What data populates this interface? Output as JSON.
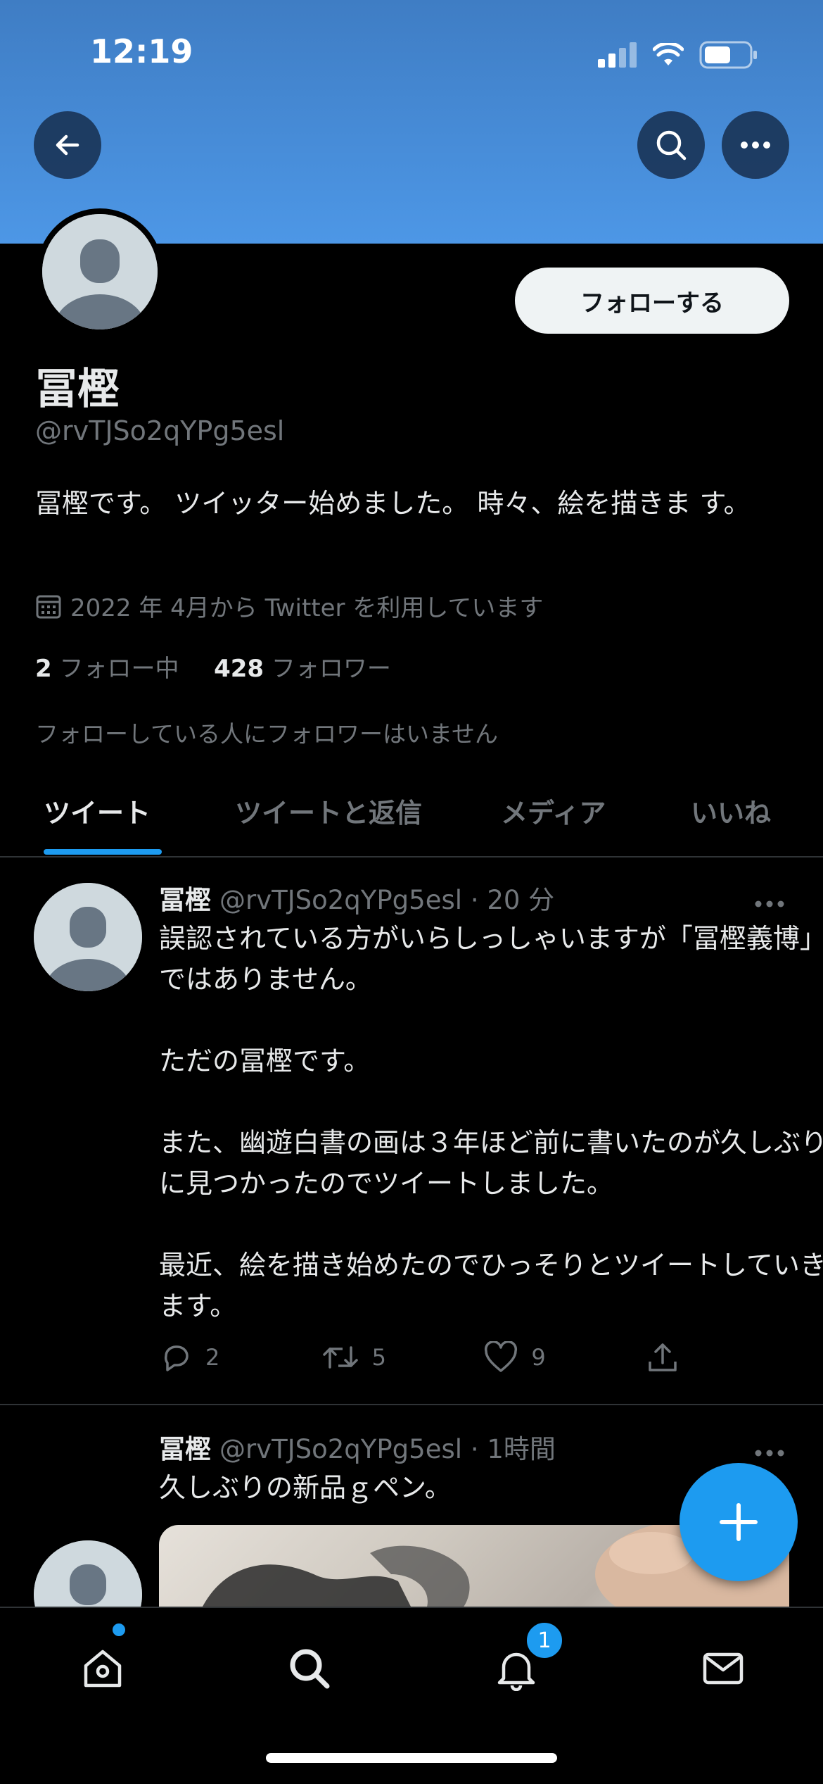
{
  "status": {
    "time": "12:19"
  },
  "header": {
    "back": "back",
    "search": "search",
    "more": "more"
  },
  "profile": {
    "follow_label": "フォローする",
    "name": "冨樫",
    "handle": "@rvTJSo2qYPg5esl",
    "bio": "冨樫です。 ツイッター始めました。 時々、絵を描きま す。",
    "joined": "2022 年 4月から Twitter を利用しています",
    "following_count": "2",
    "following_label": "フォロー中",
    "followers_count": "428",
    "followers_label": "フォロワー",
    "no_mutuals": "フォローしている人にフォロワーはいません"
  },
  "tabs": [
    "ツイート",
    "ツイートと返信",
    "メディア",
    "いいね"
  ],
  "tweets": [
    {
      "name": "冨樫",
      "handle": "@rvTJSo2qYPg5esl",
      "time": "· 20 分",
      "paragraphs": [
        "誤認されている方がいらしっしゃいますが「冨樫義博」ではありません。",
        "ただの冨樫です。",
        "また、幽遊白書の画は３年ほど前に書いたのが久しぶりに見つかったのでツイートしました。",
        "最近、絵を描き始めたのでひっそりとツイートしていきます。"
      ],
      "replies": "2",
      "retweets": "5",
      "likes": "9"
    },
    {
      "name": "冨樫",
      "handle": "@rvTJSo2qYPg5esl",
      "time": "· 1時間",
      "paragraphs": [
        "久しぶりの新品ｇペン。"
      ]
    }
  ],
  "nav": {
    "notifications_badge": "1"
  },
  "colors": {
    "accent": "#1d9bf0",
    "banner": "#4d97e6",
    "background": "#000000"
  }
}
